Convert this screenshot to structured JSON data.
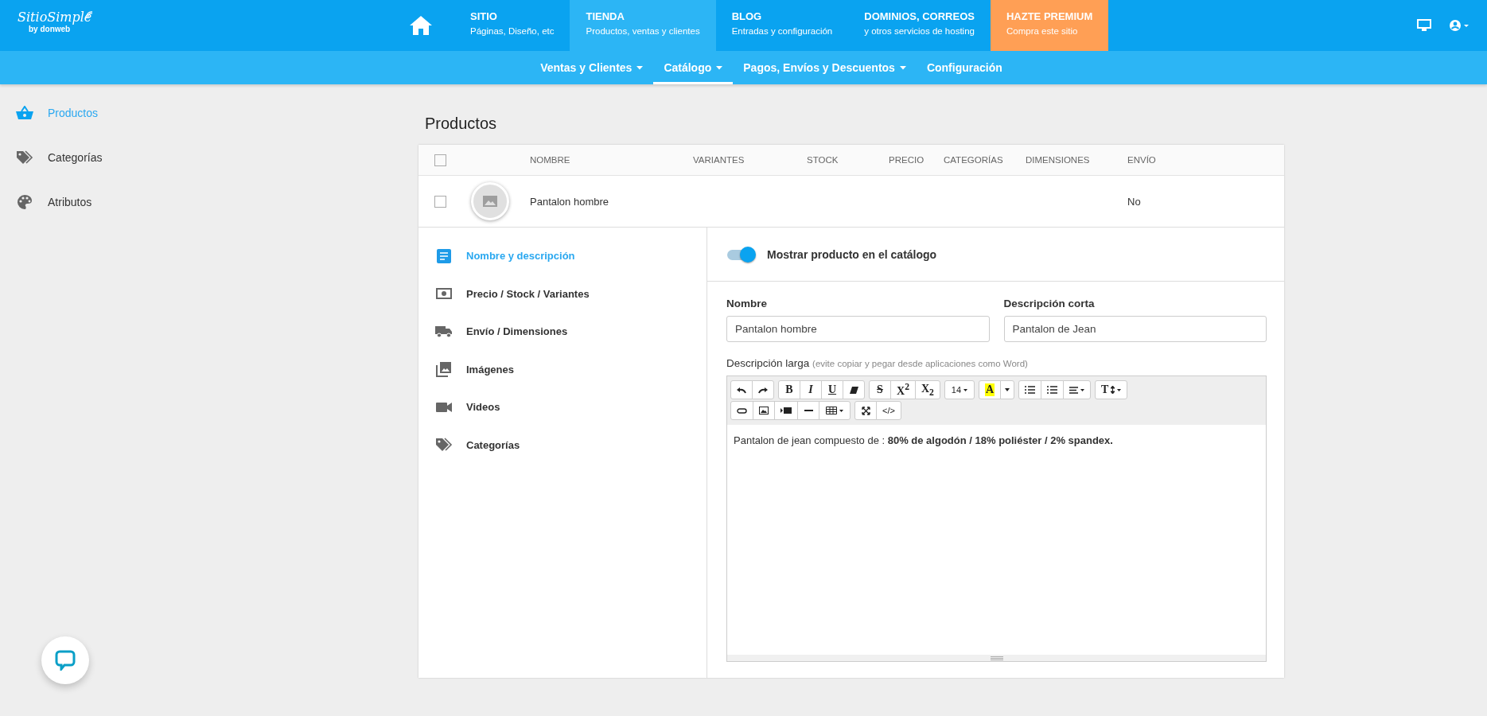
{
  "brand": {
    "name": "SitioSimple",
    "byline": "by donweb"
  },
  "nav": [
    {
      "title": "SITIO",
      "subtitle": "Páginas, Diseño, etc",
      "selected": false,
      "highlighted": false
    },
    {
      "title": "TIENDA",
      "subtitle": "Productos, ventas y clientes",
      "selected": true,
      "highlighted": false
    },
    {
      "title": "BLOG",
      "subtitle": "Entradas y configuración",
      "selected": false,
      "highlighted": false
    },
    {
      "title": "DOMINIOS, CORREOS",
      "subtitle": "y otros servicios de hosting",
      "selected": false,
      "highlighted": false
    },
    {
      "title": "HAZTE PREMIUM",
      "subtitle": "Compra este sitio",
      "selected": false,
      "highlighted": true
    }
  ],
  "subnav": [
    {
      "label": "Ventas y Clientes",
      "dropdown": true,
      "selected": false
    },
    {
      "label": "Catálogo",
      "dropdown": true,
      "selected": true
    },
    {
      "label": "Pagos, Envíos y Descuentos",
      "dropdown": true,
      "selected": false
    },
    {
      "label": "Configuración",
      "dropdown": false,
      "selected": false
    }
  ],
  "sidebar": [
    {
      "kind": "basket",
      "label": "Productos",
      "selected": true
    },
    {
      "kind": "tags",
      "label": "Categorías",
      "selected": false
    },
    {
      "kind": "palette",
      "label": "Atributos",
      "selected": false
    }
  ],
  "page_title": "Productos",
  "table": {
    "all_checked": false,
    "columns": [
      "NOMBRE",
      "VARIANTES",
      "STOCK",
      "PRECIO",
      "CATEGORÍAS",
      "DIMENSIONES",
      "ENVÍO"
    ],
    "rows": [
      {
        "checked": false,
        "name": "Pantalon hombre",
        "shipping": "No"
      }
    ]
  },
  "editor_tabs": [
    {
      "kind": "doc",
      "label": "Nombre y descripción",
      "selected": true
    },
    {
      "kind": "money",
      "label": "Precio / Stock / Variantes",
      "selected": false
    },
    {
      "kind": "truck",
      "label": "Envío / Dimensiones",
      "selected": false
    },
    {
      "kind": "images",
      "label": "Imágenes",
      "selected": false
    },
    {
      "kind": "video",
      "label": "Videos",
      "selected": false
    },
    {
      "kind": "tags",
      "label": "Categorías",
      "selected": false
    }
  ],
  "visibility": {
    "label": "Mostrar producto en el catálogo",
    "on": true
  },
  "fields": [
    {
      "label": "Nombre",
      "value": "Pantalon hombre"
    },
    {
      "label": "Descripción corta",
      "value": "Pantalon de Jean"
    }
  ],
  "long_description": {
    "label": "Descripción larga",
    "hint": "(evite copiar y pegar desde aplicaciones como Word)",
    "toolbar": [
      [
        [
          {
            "kind": "undo"
          },
          {
            "kind": "redo"
          }
        ],
        [
          {
            "kind": "bold",
            "label": "B"
          },
          {
            "kind": "italic",
            "label": "I"
          },
          {
            "kind": "underline",
            "label": "U"
          },
          {
            "kind": "eraser"
          }
        ],
        [
          {
            "kind": "strike",
            "label": "S"
          },
          {
            "kind": "sup",
            "label": "X$^{2}$"
          },
          {
            "kind": "sub",
            "label": "X$_{2}$"
          }
        ],
        [
          {
            "kind": "size",
            "label": "14"
          }
        ],
        [
          {
            "kind": "color",
            "label": "A"
          },
          {
            "kind": "caret"
          }
        ],
        [
          {
            "kind": "ul"
          },
          {
            "kind": "ol"
          },
          {
            "kind": "align"
          }
        ],
        [
          {
            "kind": "height",
            "label": "T"
          }
        ]
      ],
      [
        [
          {
            "kind": "link"
          },
          {
            "kind": "image"
          },
          {
            "kind": "video"
          },
          {
            "kind": "hr"
          },
          {
            "kind": "table"
          }
        ],
        [
          {
            "kind": "fullscreen"
          },
          {
            "kind": "code",
            "label": "</>"
          }
        ]
      ]
    ],
    "content": "Pantalon de jean compuesto de : **80% de algodón / 18% poliéster / 2% spandex.**"
  }
}
